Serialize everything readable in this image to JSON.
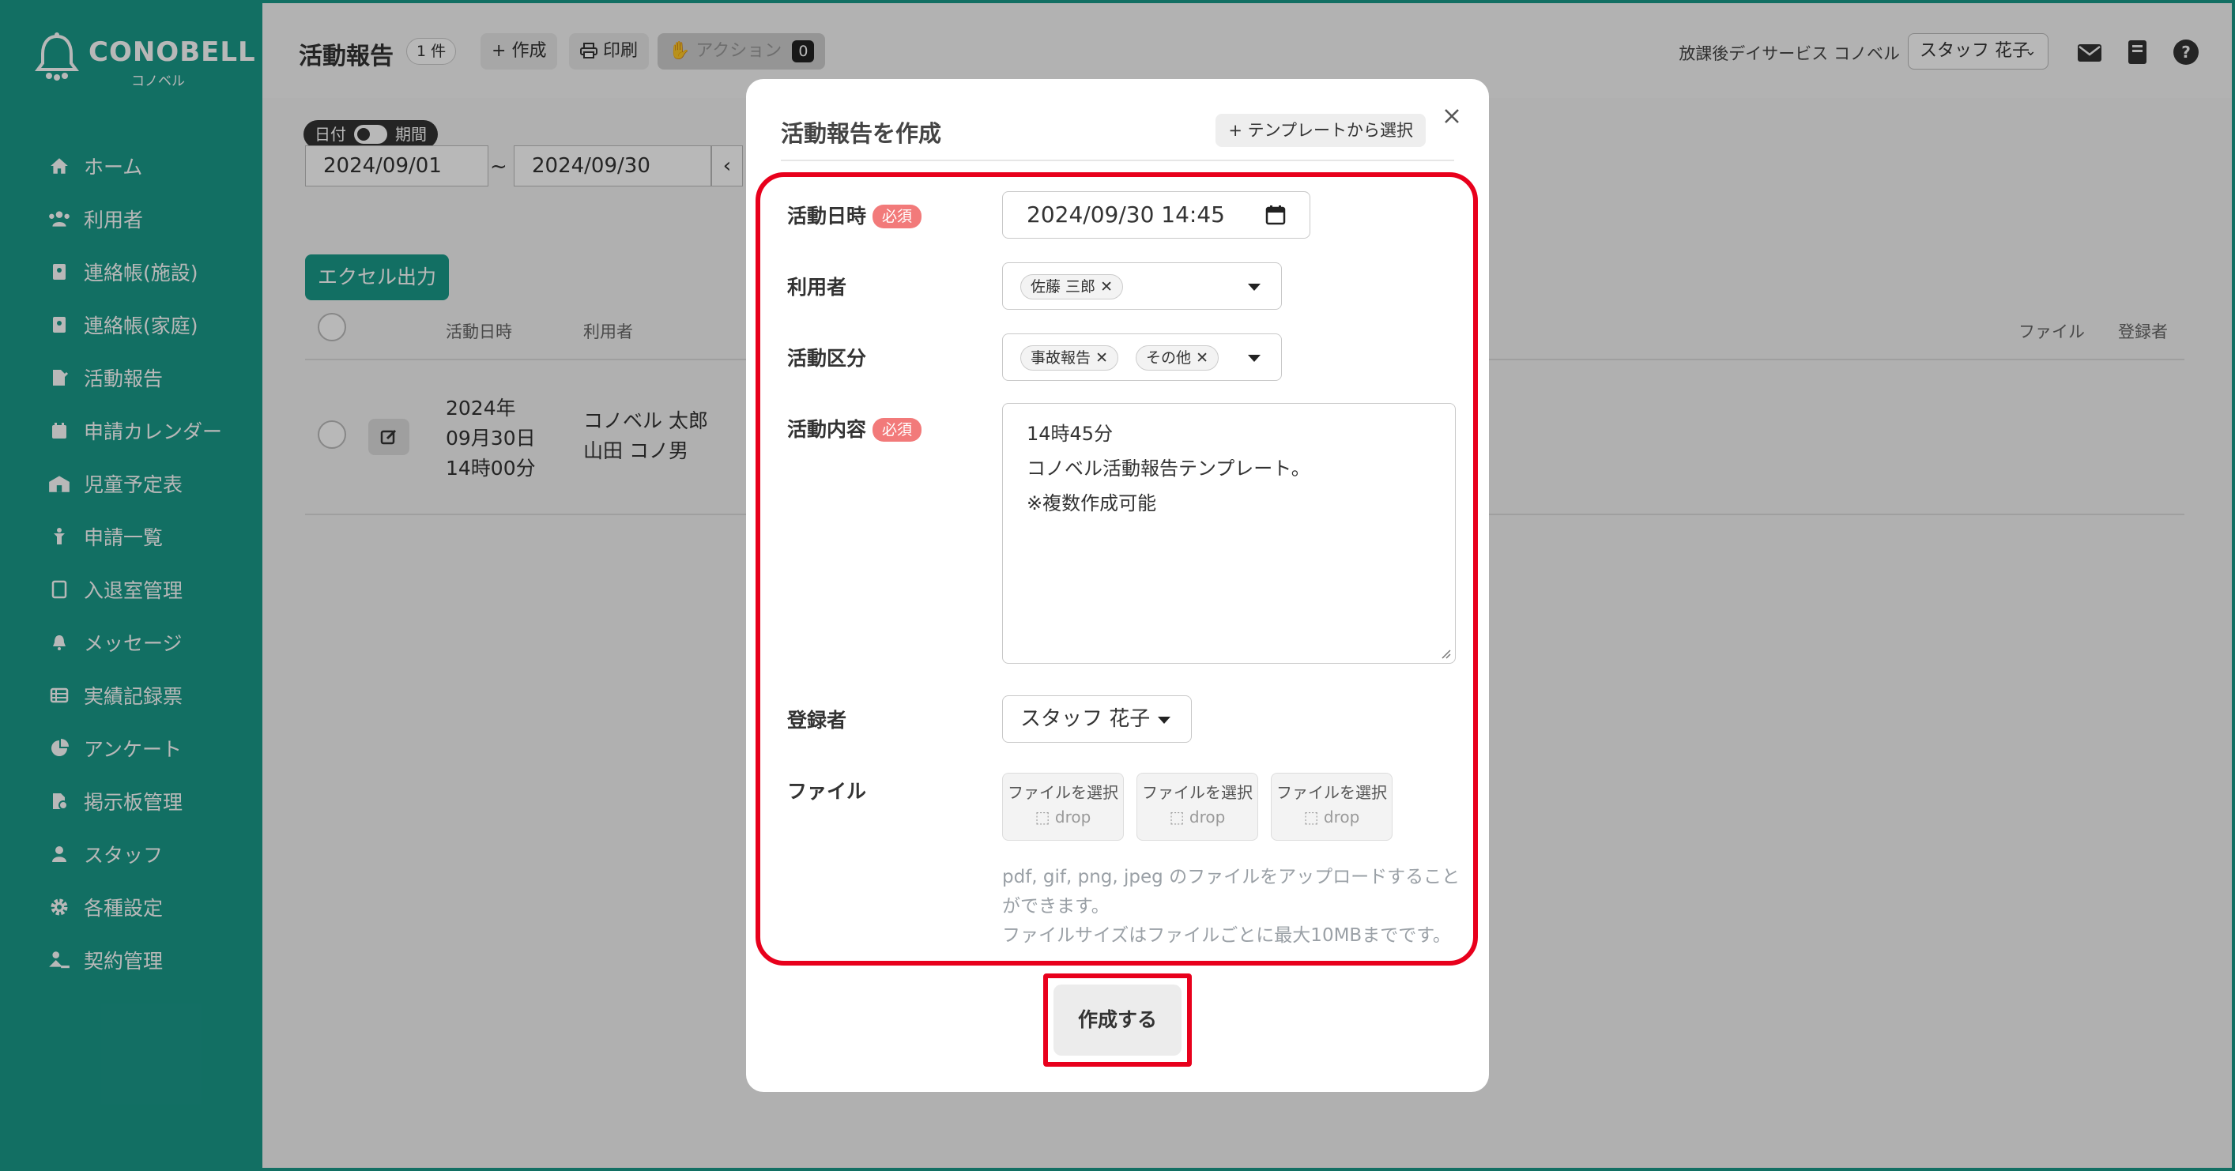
{
  "brand": {
    "name": "CONOBELL",
    "sub": "コノベル"
  },
  "sidebar": {
    "items": [
      {
        "label": "ホーム",
        "icon": "home-icon"
      },
      {
        "label": "利用者",
        "icon": "users-icon"
      },
      {
        "label": "連絡帳(施設)",
        "icon": "contact-book-icon"
      },
      {
        "label": "連絡帳(家庭)",
        "icon": "contact-book-icon"
      },
      {
        "label": "活動報告",
        "icon": "report-icon"
      },
      {
        "label": "申請カレンダー",
        "icon": "calendar-icon"
      },
      {
        "label": "児童予定表",
        "icon": "schedule-icon"
      },
      {
        "label": "申請一覧",
        "icon": "child-icon"
      },
      {
        "label": "入退室管理",
        "icon": "tablet-icon"
      },
      {
        "label": "メッセージ",
        "icon": "bell-icon"
      },
      {
        "label": "実績記録票",
        "icon": "table-icon"
      },
      {
        "label": "アンケート",
        "icon": "pie-icon"
      },
      {
        "label": "掲示板管理",
        "icon": "board-icon"
      },
      {
        "label": "スタッフ",
        "icon": "staff-icon"
      },
      {
        "label": "各種設定",
        "icon": "gear-icon"
      },
      {
        "label": "契約管理",
        "icon": "contract-icon"
      }
    ]
  },
  "header": {
    "title": "活動報告",
    "count": "1 件",
    "create_label": "作成",
    "print_label": "印刷",
    "action_label": "アクション",
    "action_count": "0",
    "facility": "放課後デイサービス コノベル",
    "staff": "スタッフ 花子"
  },
  "filter": {
    "toggle_left": "日付",
    "toggle_right": "期間",
    "date_from": "2024/09/01",
    "date_sep": "~",
    "date_to": "2024/09/30"
  },
  "list": {
    "excel_label": "エクセル出力",
    "columns": {
      "date": "活動日時",
      "user": "利用者",
      "file": "ファイル",
      "registrant": "登録者"
    },
    "rows": [
      {
        "date_lines": [
          "2024年",
          "09月30日",
          "14時00分"
        ],
        "users": [
          "コノベル 太郎",
          "山田 コノ男"
        ]
      }
    ]
  },
  "modal": {
    "title": "活動報告を作成",
    "template_label": "テンプレートから選択",
    "required_label": "必須",
    "fields": {
      "datetime": {
        "label": "活動日時",
        "value": "2024/09/30 14:45"
      },
      "user": {
        "label": "利用者",
        "chips": [
          "佐藤 三郎"
        ]
      },
      "category": {
        "label": "活動区分",
        "chips": [
          "事故報告",
          "その他"
        ]
      },
      "content": {
        "label": "活動内容",
        "lines": [
          "14時45分",
          "コノベル活動報告テンプレート。",
          "※複数作成可能"
        ]
      },
      "registrant": {
        "label": "登録者",
        "value": "スタッフ 花子"
      },
      "file": {
        "label": "ファイル",
        "button_label": "ファイルを選択",
        "drop_label": "drop",
        "help_lines": [
          "pdf, gif, png, jpeg のファイルをアップロードすることができます。",
          "ファイルサイズはファイルごとに最大10MBまでです。"
        ]
      }
    },
    "submit_label": "作成する"
  },
  "colors": {
    "brand": "#1a9a8a",
    "highlight": "#e8001c",
    "required": "#f27a7a"
  }
}
